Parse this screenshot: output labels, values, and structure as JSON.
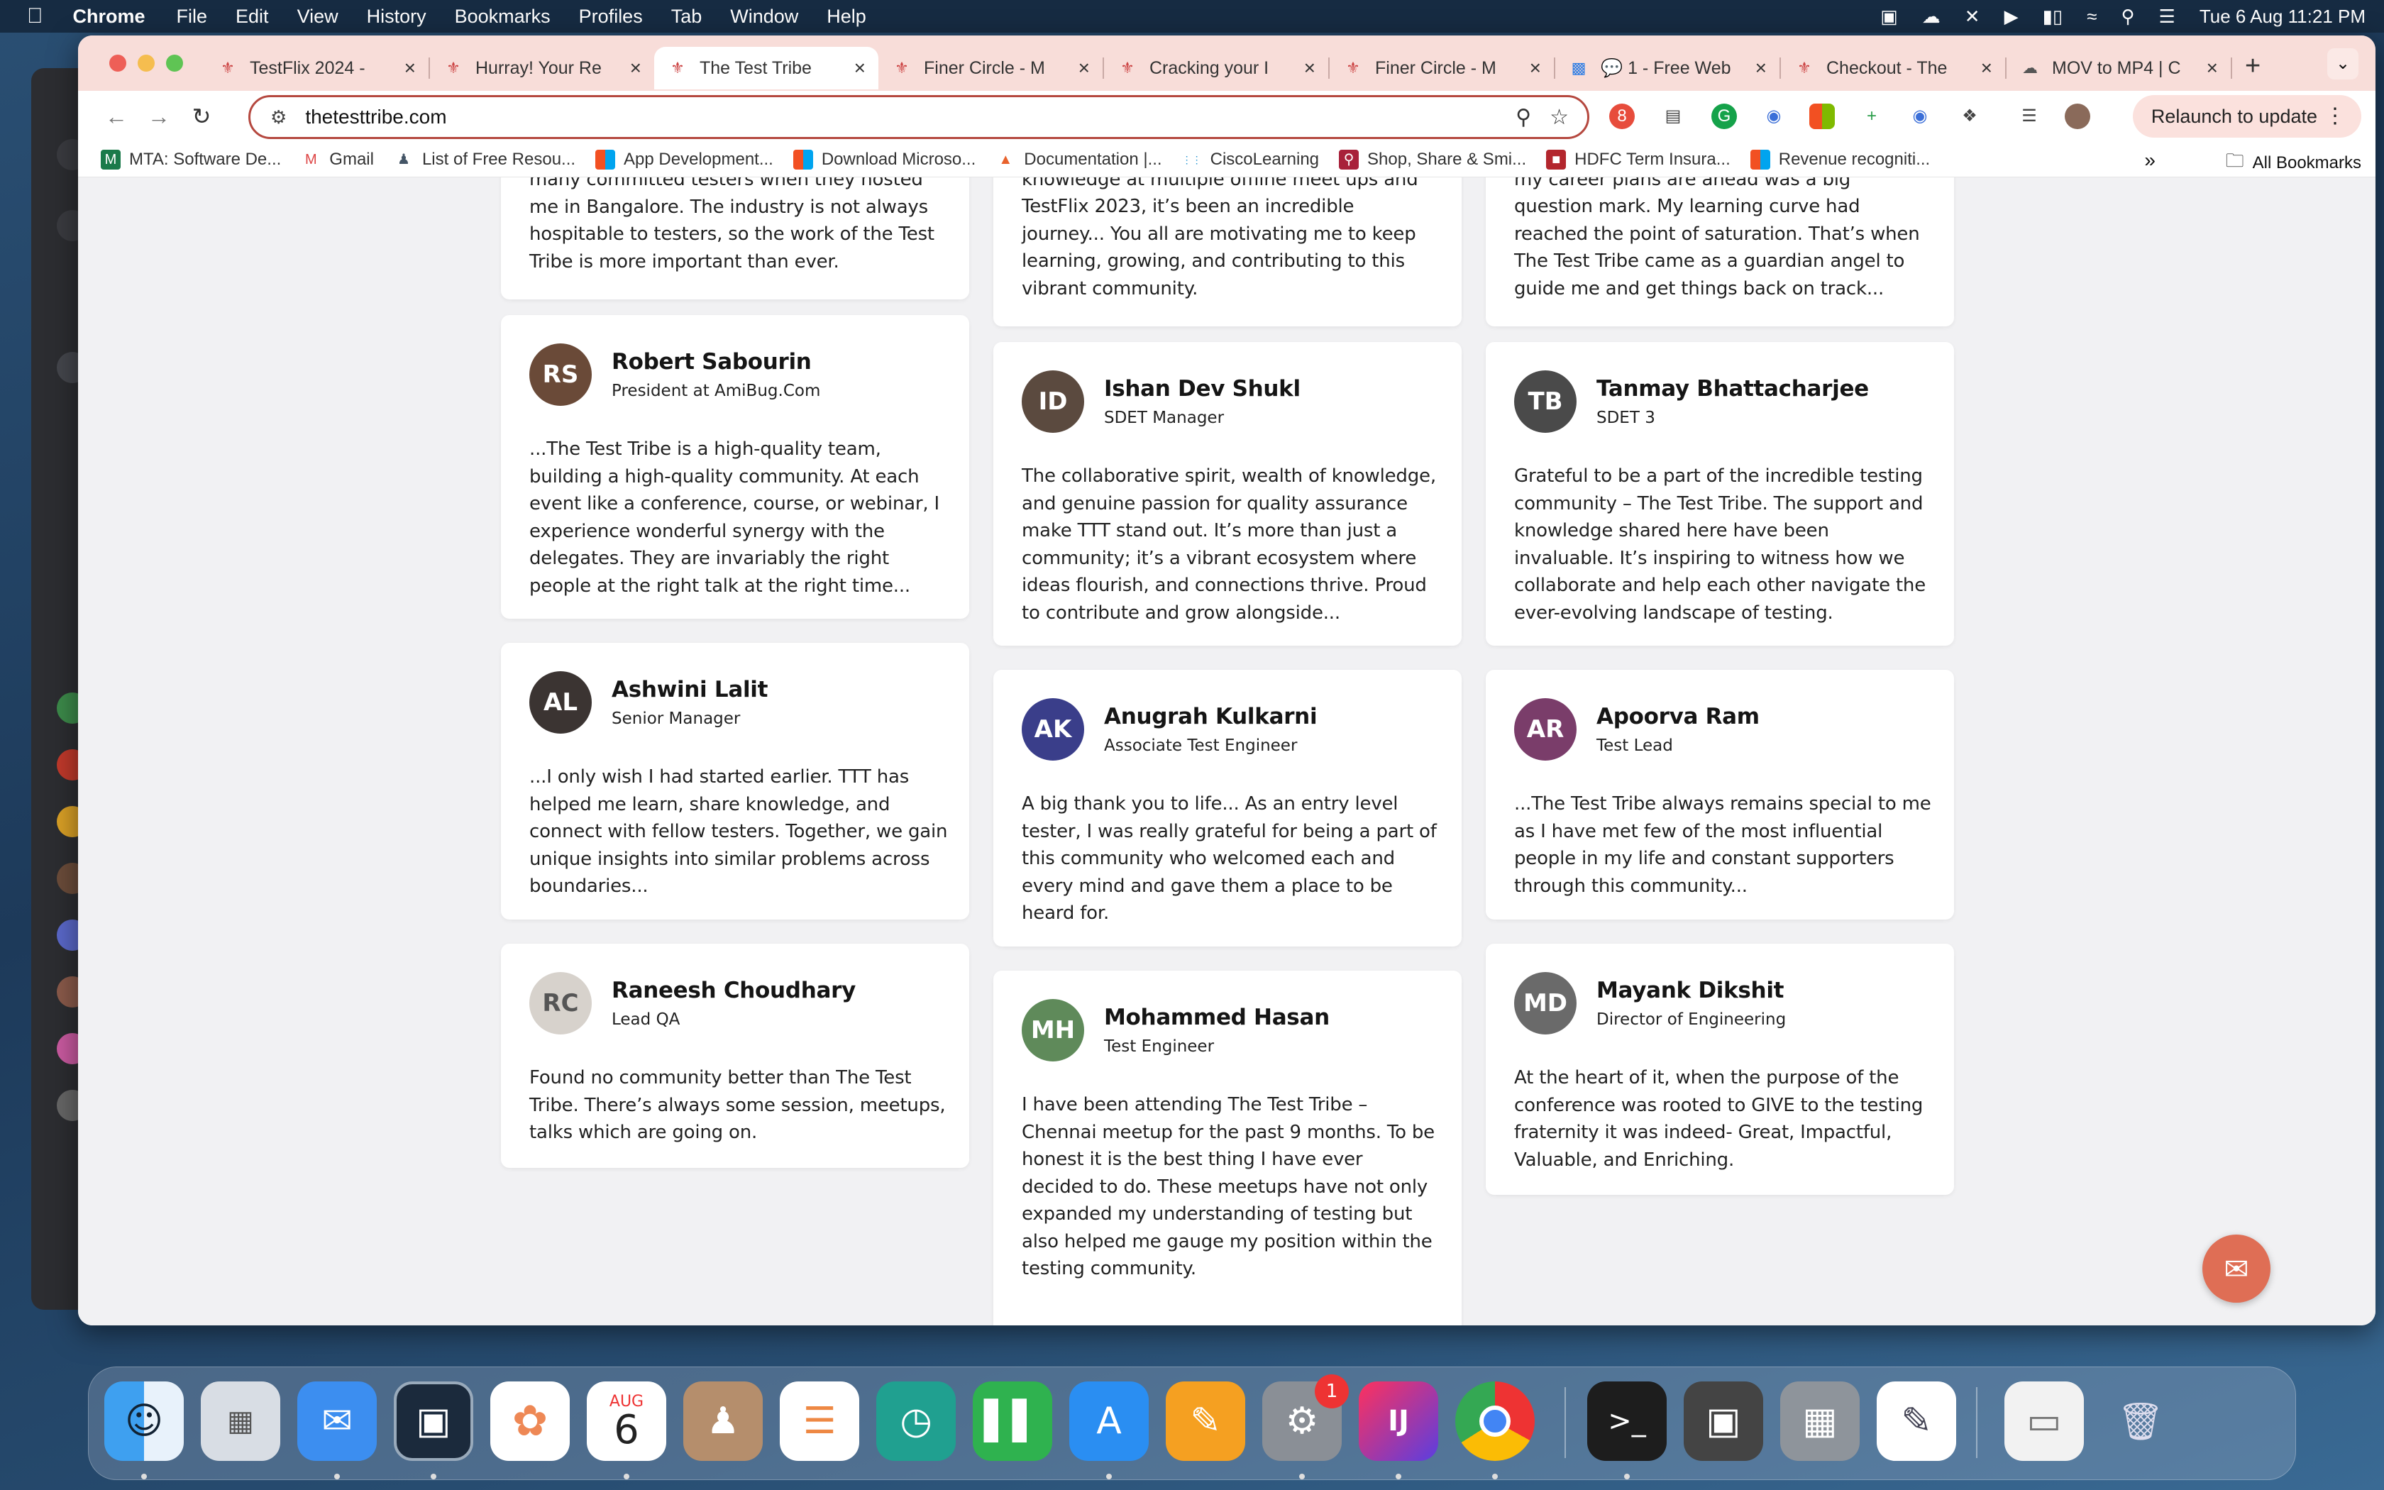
{
  "menubar": {
    "app": "Chrome",
    "items": [
      "File",
      "Edit",
      "View",
      "History",
      "Bookmarks",
      "Profiles",
      "Tab",
      "Window",
      "Help"
    ],
    "clock": "Tue 6 Aug  11:21 PM"
  },
  "tabs": [
    {
      "title": "TestFlix 2024 -",
      "active": false
    },
    {
      "title": "Hurray! Your Re",
      "active": false
    },
    {
      "title": "The Test Tribe",
      "active": true
    },
    {
      "title": "Finer Circle - M",
      "active": false
    },
    {
      "title": "Cracking your I",
      "active": false
    },
    {
      "title": "Finer Circle - M",
      "active": false
    },
    {
      "title": "💬 1 - Free Web",
      "active": false
    },
    {
      "title": "Checkout - The",
      "active": false
    },
    {
      "title": "MOV to MP4 | C",
      "active": false
    }
  ],
  "address": {
    "url": "thetesttribe.com"
  },
  "toolbar": {
    "relaunch_label": "Relaunch to update",
    "ext_badge": "8"
  },
  "bookmarks": [
    {
      "label": "MTA: Software De...",
      "icon": "mta-icon"
    },
    {
      "label": "Gmail",
      "icon": "gmail-icon"
    },
    {
      "label": "List of Free Resou...",
      "icon": "person-icon"
    },
    {
      "label": "App Development...",
      "icon": "microsoft-icon"
    },
    {
      "label": "Download Microso...",
      "icon": "microsoft-icon"
    },
    {
      "label": "Documentation  |...",
      "icon": "flame-icon"
    },
    {
      "label": "CiscoLearning",
      "icon": "cisco-icon"
    },
    {
      "label": "Shop, Share & Smi...",
      "icon": "shop-icon"
    },
    {
      "label": "HDFC Term Insura...",
      "icon": "hdfc-icon"
    },
    {
      "label": "Revenue recogniti...",
      "icon": "microsoft-icon"
    }
  ],
  "all_bookmarks_label": "All Bookmarks",
  "testimonials": {
    "col1": [
      {
        "name": "",
        "role": "",
        "text": "many committed testers when they hosted me in Bangalore. The industry is not always hospitable to testers, so the work of the Test Tribe is more important than ever."
      },
      {
        "name": "Robert Sabourin",
        "role": "President at AmiBug.Com",
        "text": "...The Test Tribe is a high-quality team, building a high-quality community. At each event like a conference, course, or webinar, I experience wonderful synergy with the delegates. They are invariably the right people at the right talk at the right time..."
      },
      {
        "name": "Ashwini Lalit",
        "role": "Senior Manager",
        "text": "...I only wish I had started earlier. TTT has helped me learn, share knowledge, and connect with fellow testers. Together, we gain unique insights into similar problems across boundaries..."
      },
      {
        "name": "Raneesh Choudhary",
        "role": "Lead QA",
        "text": "Found no community better than The Test Tribe. There’s always some session, meetups, talks which are going on."
      }
    ],
    "col2": [
      {
        "name": "",
        "role": "",
        "text": "knowledge at multiple offline meet ups and TestFlix 2023, it’s been an incredible journey... You all are motivating me to keep learning, growing, and contributing to this vibrant community."
      },
      {
        "name": "Ishan Dev Shukl",
        "role": "SDET Manager",
        "text": "The collaborative spirit, wealth of knowledge, and genuine passion for quality assurance make TTT stand out. It’s more than just a community; it’s a vibrant ecosystem where ideas flourish, and connections thrive. Proud to contribute and grow alongside..."
      },
      {
        "name": "Anugrah Kulkarni",
        "role": "Associate Test Engineer",
        "text": "A big thank you to life... As an entry level tester, I was really grateful for being a part of this community who welcomed each and every mind and gave them a place to be heard for."
      },
      {
        "name": "Mohammed Hasan",
        "role": "Test Engineer",
        "text": "I have been attending The Test Tribe – Chennai meetup for the past 9 months. To be honest it is the best thing I have ever decided to do. These meetups have not only expanded my understanding of testing but also helped me gauge my position within the testing community."
      }
    ],
    "col3": [
      {
        "name": "",
        "role": "",
        "text": "my career plans are ahead was a big question mark. My learning curve had reached the point of saturation. That’s when The Test Tribe came as a guardian angel to guide me and get things back on track..."
      },
      {
        "name": "Tanmay Bhattacharjee",
        "role": "SDET 3",
        "text": "Grateful to be a part of the incredible testing community – The Test Tribe. The support and knowledge shared here have been invaluable. It’s inspiring to witness how we collaborate and help each other navigate the ever-evolving landscape of testing."
      },
      {
        "name": "Apoorva Ram",
        "role": "Test Lead",
        "text": "...The Test Tribe always remains special to me as I have met few of the most influential people in my life and constant supporters through this community..."
      },
      {
        "name": "Mayank Dikshit",
        "role": "Director of Engineering",
        "text": "At the heart of it, when the purpose of the conference was rooted to GIVE to the testing fraternity it was indeed- Great, Impactful, Valuable, and Enriching."
      }
    ]
  },
  "dock": {
    "calendar_month": "AUG",
    "calendar_day": "6",
    "settings_badge": "1",
    "intellij_label": "IJ"
  },
  "colors": {
    "accent": "#b5483f",
    "tabstrip": "#f8ddd9",
    "chat": "#df6e55"
  }
}
